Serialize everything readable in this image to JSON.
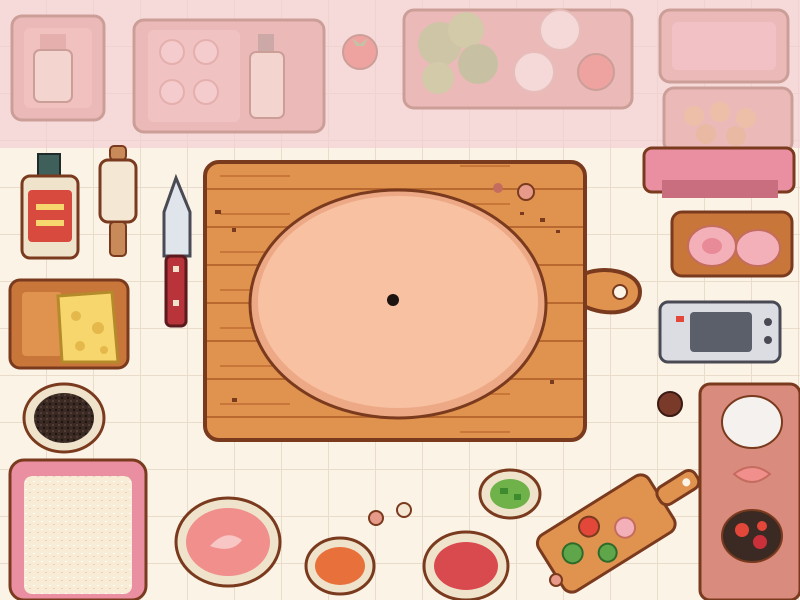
{
  "scene": {
    "colors": {
      "floor": "#fbf3e6",
      "tile_line": "#eadccb",
      "wood": "#e0924f",
      "wood_dark": "#b9692f",
      "outline": "#7a3a1e",
      "dough": "#f7c1a2",
      "dough_rim": "#eda986",
      "shelf_overlay": "#f3cfd3",
      "tomato_red": "#e2473a",
      "cheese": "#f7d66e",
      "leaf_green": "#5fa64a",
      "sauce_pink": "#f08f8c"
    },
    "icons": {
      "pizza_dough": "dough-circle-icon",
      "knife": "knife-icon",
      "rolling_pin": "rolling-pin-icon",
      "oven": "toaster-oven-icon",
      "tomato": "tomato-icon"
    }
  }
}
